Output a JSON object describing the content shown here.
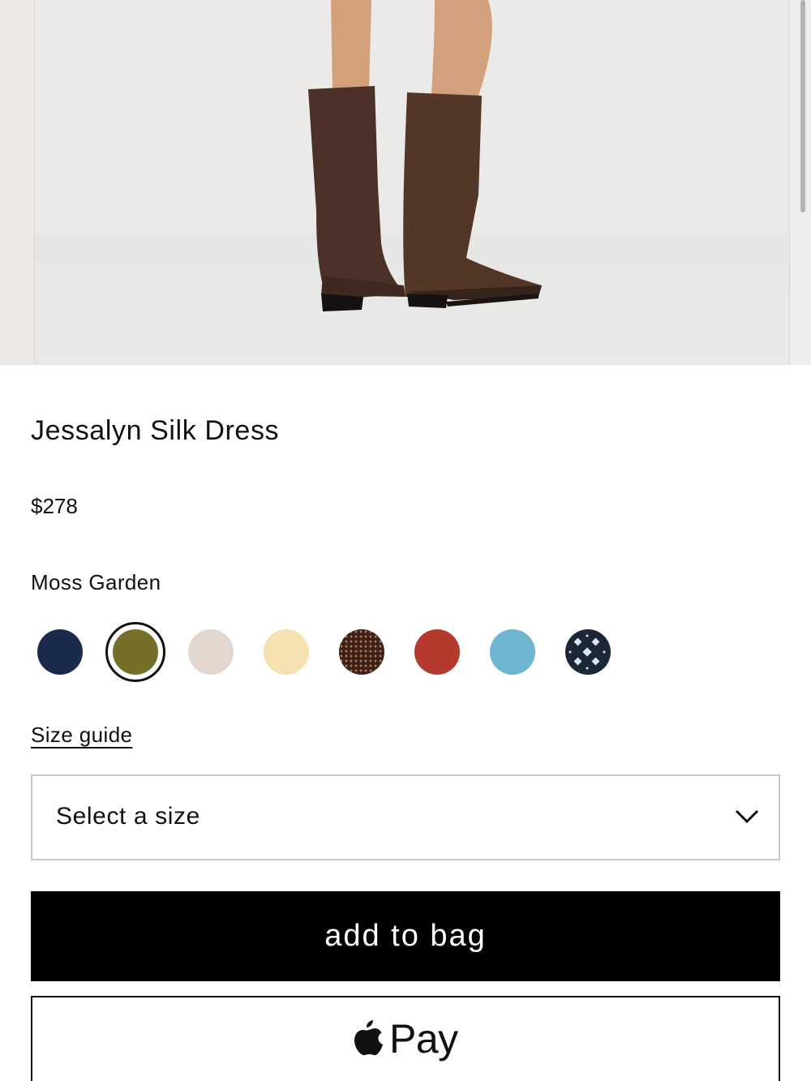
{
  "product": {
    "title": "Jessalyn Silk Dress",
    "price": "$278",
    "selected_color_name": "Moss Garden"
  },
  "swatches": [
    {
      "name": "navy",
      "color": "#1b2a4c",
      "selected": false
    },
    {
      "name": "moss-garden",
      "color": "#74702a",
      "selected": true
    },
    {
      "name": "blush",
      "color": "#e3d7cf",
      "selected": false
    },
    {
      "name": "butter",
      "color": "#f6e2b0",
      "selected": false
    },
    {
      "name": "brown-dot",
      "color": "#3b2118",
      "selected": false
    },
    {
      "name": "red",
      "color": "#b43a2e",
      "selected": false
    },
    {
      "name": "sky-blue",
      "color": "#6eb5d0",
      "selected": false
    },
    {
      "name": "navy-medallion",
      "color": "#1b2735",
      "selected": false
    }
  ],
  "size_guide_label": "Size guide",
  "size_select": {
    "label": "Select a size"
  },
  "add_to_bag_label": "add to bag",
  "apple_pay": {
    "label": "Pay"
  },
  "icons": {
    "chevron": "chevron-down-icon",
    "apple": "apple-logo-icon"
  },
  "colors": {
    "primary_button": "#000000",
    "select_border": "#c9c9c9",
    "text": "#111111"
  }
}
